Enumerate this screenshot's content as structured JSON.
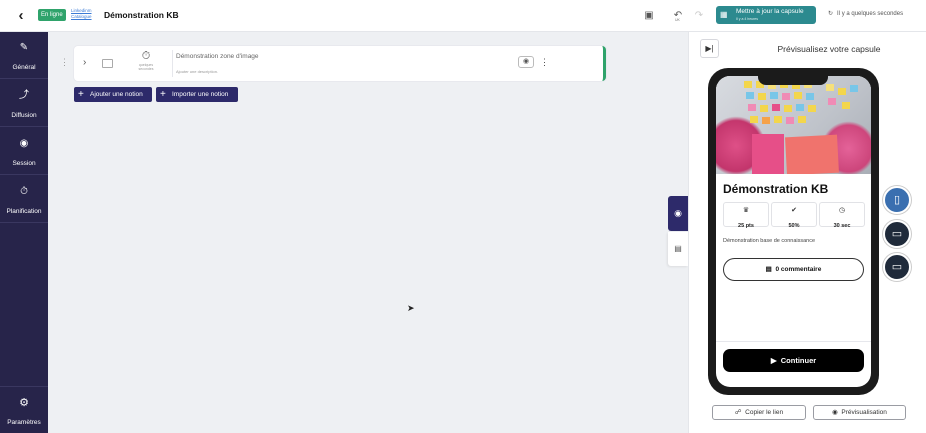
{
  "topbar": {
    "status_badge": "En ligne",
    "breadcrumb_line1": "Linkedinm",
    "breadcrumb_line2": "Catalogue",
    "page_title": "Démonstration KB",
    "undo_small": "UK",
    "update_label": "Mettre à jour la capsule",
    "update_sub": "Il y a 4 heures",
    "saved_text": "Il y a quelques secondes"
  },
  "sidebar": {
    "items": [
      {
        "label": "Général",
        "icon": "pencil-icon"
      },
      {
        "label": "Diffusion",
        "icon": "share-icon"
      },
      {
        "label": "Session",
        "icon": "target-icon"
      },
      {
        "label": "Planification",
        "icon": "stopwatch-icon"
      }
    ],
    "bottom": {
      "label": "Paramètres",
      "icon": "gear-icon"
    }
  },
  "editor": {
    "notion": {
      "title": "Démonstration zone d'image",
      "description": "Ajouter une description.",
      "timer_line1": "quelques",
      "timer_line2": "secondes"
    },
    "add_notion": "Ajouter une notion",
    "import_notion": "Importer une notion"
  },
  "preview": {
    "title": "Prévisualisez votre capsule",
    "capsule_title": "Démonstration KB",
    "stats": [
      {
        "icon": "trophy-icon",
        "value": "25 pts"
      },
      {
        "icon": "check-circle-icon",
        "value": "50%"
      },
      {
        "icon": "clock-icon",
        "value": "30 sec"
      }
    ],
    "description": "Démonstration base de connaissance",
    "comment_label": "0 commentaire",
    "continue_label": "Continuer",
    "copy_link": "Copier le lien",
    "preview_btn": "Prévisualisation"
  },
  "colors": {
    "sidebar_bg": "#27244a",
    "accent_teal": "#2c8a8f",
    "online_green": "#2fa36b",
    "primary_button": "#2d2a6a",
    "device_active": "#3a6fb0"
  }
}
